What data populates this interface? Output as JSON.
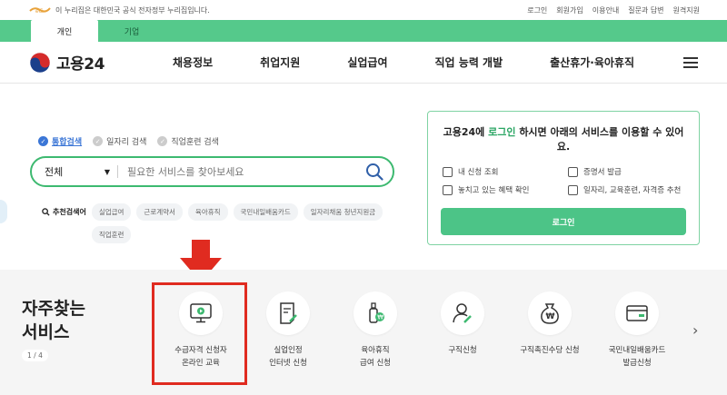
{
  "topbar": {
    "notice": "이 누리집은 대한민국 공식 전자정부 누리집입니다.",
    "links": [
      "로그인",
      "회원가입",
      "이용안내",
      "질문과 답변",
      "원격지원"
    ]
  },
  "tabs": [
    {
      "label": "개인",
      "active": true
    },
    {
      "label": "기업",
      "active": false
    }
  ],
  "header": {
    "brand": "고용24",
    "nav": [
      "채용정보",
      "취업지원",
      "실업급여",
      "직업 능력 개발",
      "출산휴가·육아휴직"
    ]
  },
  "search": {
    "options": [
      {
        "label": "통합검색",
        "active": true
      },
      {
        "label": "일자리 검색",
        "active": false
      },
      {
        "label": "직업훈련 검색",
        "active": false
      }
    ],
    "scope": "전체",
    "placeholder": "필요한 서비스를 찾아보세요"
  },
  "recommend": {
    "label": "추천검색어",
    "chips": [
      "실업급여",
      "근로계약서",
      "육아휴직",
      "국민내일배움카드",
      "일자리채움 청년지원금",
      "직업훈련"
    ]
  },
  "login_card": {
    "title_prefix": "고용24에 ",
    "title_link": "로그인",
    "title_suffix": " 하시면 아래의 서비스를 이용할 수 있어요.",
    "features": [
      "내 신청 조회",
      "증명서 발급",
      "놓치고 있는 혜택 확인",
      "일자리, 교육훈련, 자격증 추천"
    ],
    "button": "로그인"
  },
  "services": {
    "title": "자주찾는\n서비스",
    "pager": "1 / 4",
    "items": [
      {
        "label": "수급자격 신청자\n온라인 교육",
        "icon": "monitor-play-icon"
      },
      {
        "label": "실업인정\n인터넷 신청",
        "icon": "document-pen-icon"
      },
      {
        "label": "육아휴직\n급여 신청",
        "icon": "baby-bottle-coin-icon"
      },
      {
        "label": "구직신청",
        "icon": "person-edit-icon"
      },
      {
        "label": "구직촉진수당 신청",
        "icon": "money-bag-icon"
      },
      {
        "label": "국민내일배움카드\n발급신청",
        "icon": "card-icon"
      }
    ]
  },
  "colors": {
    "brand_green": "#55c98b",
    "search_border": "#3db970",
    "link_blue": "#3b76d6",
    "highlight_red": "#e02b20"
  }
}
